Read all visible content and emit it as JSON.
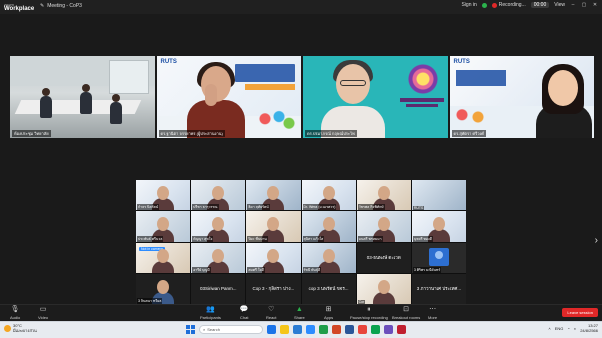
{
  "window": {
    "brand_top": "zoom",
    "brand_bottom": "Workplace",
    "meeting_title": "Meeting - CoP3",
    "sign_in": "Sign in",
    "recording": "Recording...",
    "timer": "00:00",
    "view": "View"
  },
  "speakers": [
    {
      "name": "ห้องประชุม วิทยาลัย"
    },
    {
      "name": "ดร.ฐานิตา จรรยาพร (ผู้ประสานงาน)"
    },
    {
      "name": "ดร.ปรมาภรณ์ กฤษณ์ประไพ"
    },
    {
      "name": "ดร.สุพัตรา ศรีวงศ์"
    }
  ],
  "gallery": [
    {
      "name": "กำธร นิลรัตน์"
    },
    {
      "name": "ปรีชา ธารุวรรณ"
    },
    {
      "name": "ธิดา ฤทัยรัตน์"
    },
    {
      "name": "Dr. Wera (ม.นเรศวร)"
    },
    {
      "name": "วัชรพล กิจพิทักษ์"
    },
    {
      "name": "RUTS"
    },
    {
      "name": "ประพันธ์ ศรีนวล"
    },
    {
      "name": "กัญญา สุขใจ"
    },
    {
      "name": "ปิยะ ชื่นบาน"
    },
    {
      "name": "สุนิสา แก้วใส"
    },
    {
      "name": "มนตรี พรหมมา"
    },
    {
      "name": "นุชจรี ทองดี"
    },
    {
      "name": "Not in camera",
      "badge": "Not in camera"
    },
    {
      "name": "อารีย์ บุญมี"
    },
    {
      "name": "สมศรี ใจดี"
    },
    {
      "name": "รัชนี พันธ์ุดี"
    },
    {
      "name": "03-ธนพงษ์ ตะเวด"
    },
    {
      "name": "3 ศิริพร มณีจันทร์"
    },
    {
      "name": "3 จินตนา ทวีผล"
    },
    {
      "name": "03Siriwan Panma..."
    },
    {
      "name": "Cop 3 - กุลิสรา ปาง..."
    },
    {
      "name": "cop 3 นพรัตน์ ขจร..."
    },
    {
      "name": "Cor"
    },
    {
      "name": "3 ภาวานาเศ ประเทศ..."
    }
  ],
  "gallery_text": {
    "center_name": "03-ธนพงษ์ ตะเวด",
    "siriwan": "03Siriwan Panm...",
    "cop3": "Cop 3 - กุลิสรา ปาง...",
    "cop3b": "cop 3 นพรัตน์ ขจร...",
    "bhava": "3 ภาวานาเศ ประเทศ..."
  },
  "controls": {
    "audio": "Audio",
    "video": "Video",
    "participants": "Participants",
    "participants_count": "36",
    "chat": "Chat",
    "react": "React",
    "share": "Share",
    "apps": "Apps",
    "pause_recording": "Pause/stop recording",
    "breakout_rooms": "Breakout rooms",
    "more": "More",
    "leave": "Leave session"
  },
  "taskbar": {
    "temp": "30°C",
    "weather": "มีเมฆบางส่วน",
    "search": "Search",
    "lang": "ENG",
    "time": "13:27",
    "date": "24/8/2566"
  }
}
